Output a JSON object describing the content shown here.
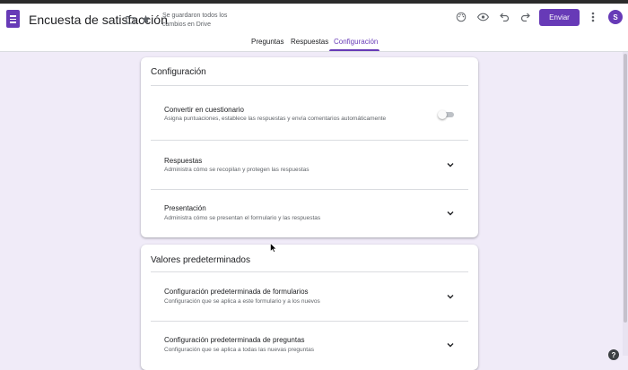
{
  "header": {
    "doc_title": "Encuesta de satisfacción",
    "save_status": "Se guardaron todos los cambios en Drive",
    "send_label": "Enviar",
    "avatar_initial": "S",
    "icons": [
      "forms-logo-icon",
      "folder-icon",
      "star-icon",
      "palette-icon",
      "preview-eye-icon",
      "undo-icon",
      "redo-icon",
      "more-vert-icon"
    ]
  },
  "tabs": [
    {
      "label": "Preguntas",
      "active": false
    },
    {
      "label": "Respuestas",
      "active": false
    },
    {
      "label": "Configuración",
      "active": true
    }
  ],
  "config_card": {
    "title": "Configuración",
    "rows": [
      {
        "title": "Convertir en cuestionario",
        "subtitle": "Asigna puntuaciones, establece las respuestas y envía comentarios automáticamente",
        "control": "toggle",
        "toggle_on": false
      },
      {
        "title": "Respuestas",
        "subtitle": "Administra cómo se recopilan y protegen las respuestas",
        "control": "chevron-down"
      },
      {
        "title": "Presentación",
        "subtitle": "Administra cómo se presentan el formulario y las respuestas",
        "control": "chevron-down"
      }
    ]
  },
  "defaults_card": {
    "title": "Valores predeterminados",
    "rows": [
      {
        "title": "Configuración predeterminada de formularios",
        "subtitle": "Configuración que se aplica a este formulario y a los nuevos",
        "control": "chevron-down"
      },
      {
        "title": "Configuración predeterminada de preguntas",
        "subtitle": "Configuración que se aplica a todas las nuevas preguntas",
        "control": "chevron-down"
      }
    ]
  },
  "help_label": "?",
  "colors": {
    "accent": "#673ab7",
    "background": "#f0ebf8",
    "card": "#ffffff",
    "divider": "#dadce0"
  }
}
